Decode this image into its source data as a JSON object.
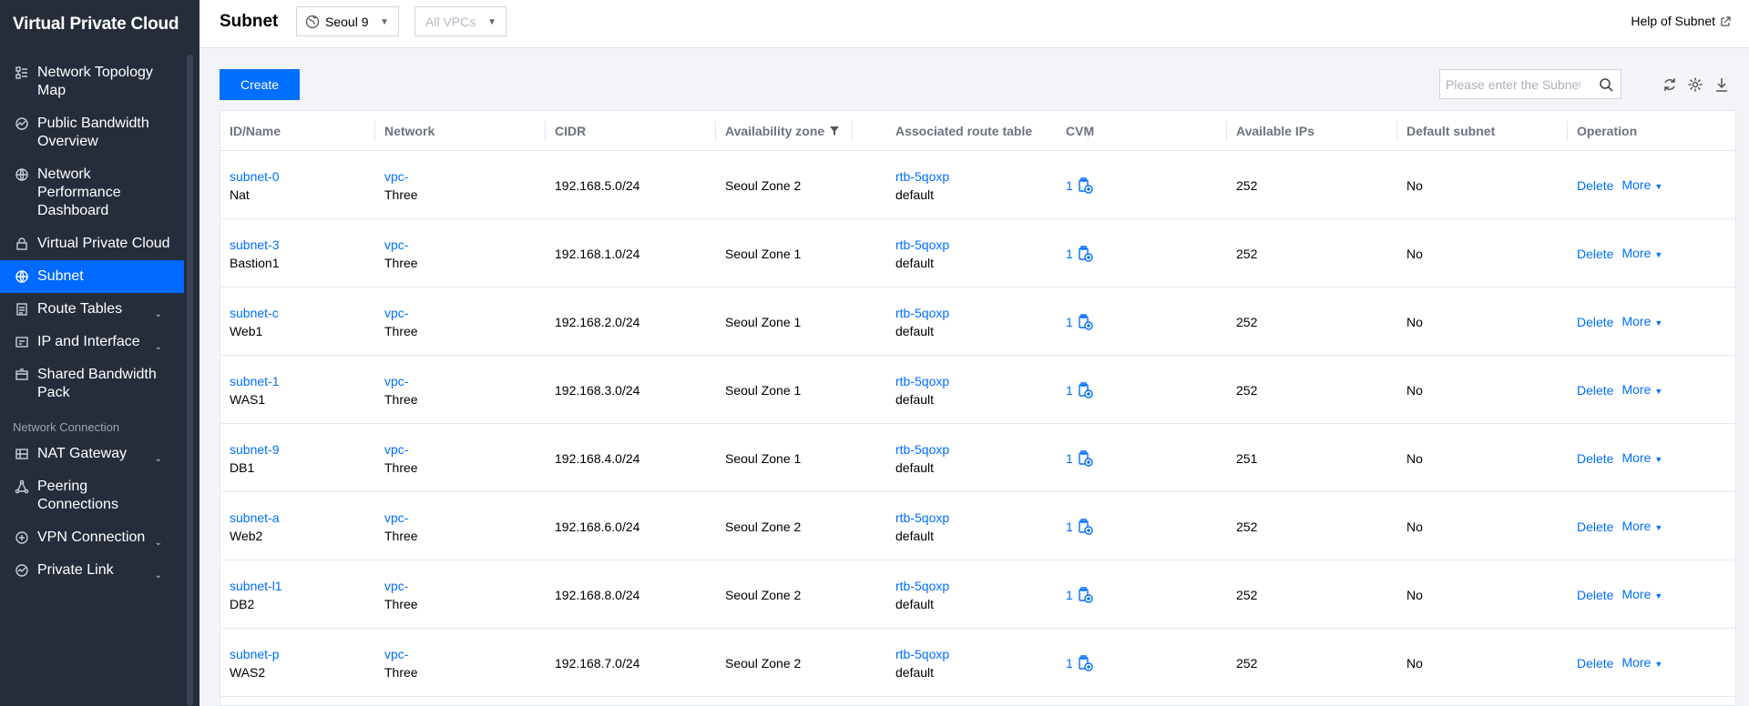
{
  "sidebar": {
    "title": "Virtual Private Cloud",
    "items": [
      {
        "label": "Network Topology Map",
        "icon": "topology-icon",
        "chevron": false,
        "active": false
      },
      {
        "label": "Public Bandwidth Overview",
        "icon": "bandwidth-icon",
        "chevron": false,
        "active": false
      },
      {
        "label": "Network Performance Dashboard",
        "icon": "globe-dashboard-icon",
        "chevron": false,
        "active": false
      },
      {
        "label": "Virtual Private Cloud",
        "icon": "lock-icon",
        "chevron": false,
        "active": false
      },
      {
        "label": "Subnet",
        "icon": "globe-icon",
        "chevron": false,
        "active": true
      },
      {
        "label": "Route Tables",
        "icon": "document-icon",
        "chevron": true,
        "active": false
      },
      {
        "label": "IP and Interface",
        "icon": "interface-icon",
        "chevron": true,
        "active": false
      },
      {
        "label": "Shared Bandwidth Pack",
        "icon": "pack-icon",
        "chevron": false,
        "active": false
      }
    ],
    "section_label": "Network Connection",
    "items2": [
      {
        "label": "NAT Gateway",
        "icon": "gateway-icon",
        "chevron": true
      },
      {
        "label": "Peering Connections",
        "icon": "peering-icon",
        "chevron": false
      },
      {
        "label": "VPN Connection",
        "icon": "vpn-icon",
        "chevron": true
      },
      {
        "label": "Private Link",
        "icon": "link-icon",
        "chevron": true
      }
    ]
  },
  "header": {
    "title": "Subnet",
    "region": "Seoul 9",
    "vpc_filter": "All VPCs",
    "help": "Help of Subnet"
  },
  "toolbar": {
    "create_label": "Create",
    "search_placeholder": "Please enter the Subnet"
  },
  "table": {
    "columns": [
      "ID/Name",
      "Network",
      "CIDR",
      "Availability zone",
      "Associated route table",
      "CVM",
      "Available IPs",
      "Default subnet",
      "Operation"
    ],
    "delete_label": "Delete",
    "more_label": "More",
    "rows": [
      {
        "id": "subnet-0",
        "name": "Nat",
        "vpc": "vpc-",
        "vpc_name": "Three",
        "cidr": "192.168.5.0/24",
        "zone": "Seoul Zone 2",
        "rtb": "rtb-5qoxp",
        "rtb_name": "default",
        "cvm": "1",
        "ips": "252",
        "default": "No"
      },
      {
        "id": "subnet-3",
        "name": "Bastion1",
        "vpc": "vpc-",
        "vpc_name": "Three",
        "cidr": "192.168.1.0/24",
        "zone": "Seoul Zone 1",
        "rtb": "rtb-5qoxp",
        "rtb_name": "default",
        "cvm": "1",
        "ips": "252",
        "default": "No"
      },
      {
        "id": "subnet-c",
        "name": "Web1",
        "vpc": "vpc-",
        "vpc_name": "Three",
        "cidr": "192.168.2.0/24",
        "zone": "Seoul Zone 1",
        "rtb": "rtb-5qoxp",
        "rtb_name": "default",
        "cvm": "1",
        "ips": "252",
        "default": "No"
      },
      {
        "id": "subnet-1",
        "name": "WAS1",
        "vpc": "vpc-",
        "vpc_name": "Three",
        "cidr": "192.168.3.0/24",
        "zone": "Seoul Zone 1",
        "rtb": "rtb-5qoxp",
        "rtb_name": "default",
        "cvm": "1",
        "ips": "252",
        "default": "No"
      },
      {
        "id": "subnet-9",
        "name": "DB1",
        "vpc": "vpc-",
        "vpc_name": "Three",
        "cidr": "192.168.4.0/24",
        "zone": "Seoul Zone 1",
        "rtb": "rtb-5qoxp",
        "rtb_name": "default",
        "cvm": "1",
        "ips": "251",
        "default": "No"
      },
      {
        "id": "subnet-a",
        "name": "Web2",
        "vpc": "vpc-",
        "vpc_name": "Three",
        "cidr": "192.168.6.0/24",
        "zone": "Seoul Zone 2",
        "rtb": "rtb-5qoxp",
        "rtb_name": "default",
        "cvm": "1",
        "ips": "252",
        "default": "No"
      },
      {
        "id": "subnet-l1",
        "name": "DB2",
        "vpc": "vpc-",
        "vpc_name": "Three",
        "cidr": "192.168.8.0/24",
        "zone": "Seoul Zone 2",
        "rtb": "rtb-5qoxp",
        "rtb_name": "default",
        "cvm": "1",
        "ips": "252",
        "default": "No"
      },
      {
        "id": "subnet-p",
        "name": "WAS2",
        "vpc": "vpc-",
        "vpc_name": "Three",
        "cidr": "192.168.7.0/24",
        "zone": "Seoul Zone 2",
        "rtb": "rtb-5qoxp",
        "rtb_name": "default",
        "cvm": "1",
        "ips": "252",
        "default": "No"
      }
    ]
  },
  "colors": {
    "sidebar_bg": "#262d3a",
    "accent": "#006eff",
    "active_nav": "#0069ff"
  }
}
